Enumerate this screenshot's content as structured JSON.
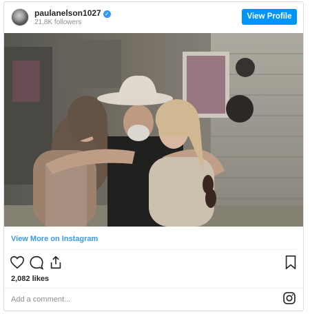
{
  "header": {
    "username": "paulanelson1027",
    "verified_mark": "✓",
    "followers": "21.8K followers",
    "view_profile_label": "View Profile"
  },
  "photo": {
    "description_icon": "instagram-photo"
  },
  "footer": {
    "view_more_label": "View More on Instagram",
    "likes": "2,082 likes",
    "comment_placeholder": "Add a comment..."
  },
  "colors": {
    "accent": "#0095f6",
    "link": "#3897f0",
    "muted": "#8e8e8e",
    "border": "#dbdbdb"
  },
  "icons": [
    "heart-icon",
    "comment-icon",
    "share-icon",
    "bookmark-icon",
    "instagram-logo-icon",
    "verified-badge-icon"
  ]
}
